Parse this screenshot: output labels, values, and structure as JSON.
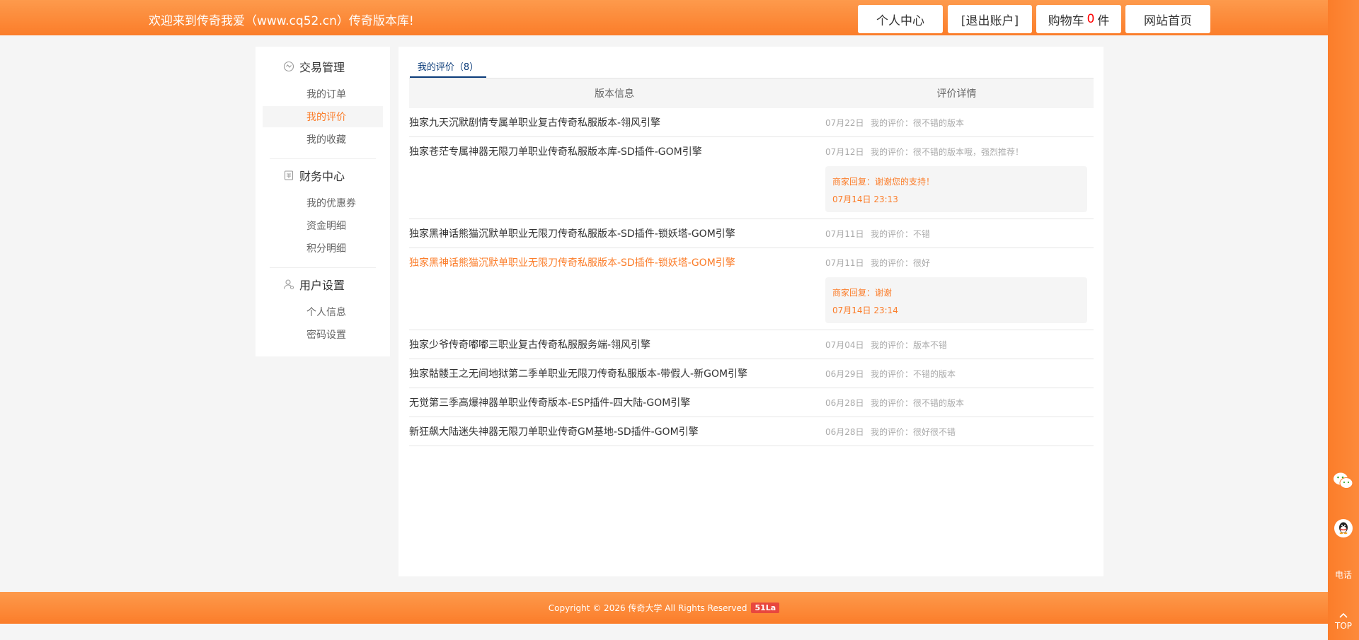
{
  "header": {
    "welcome": "欢迎来到传奇我爱（www.cq52.cn）传奇版本库!",
    "nav": {
      "personal_center": "个人中心",
      "logout": "[退出账户]",
      "cart_prefix": "购物车",
      "cart_count": "0",
      "cart_suffix": "件",
      "home": "网站首页"
    }
  },
  "sidebar": {
    "sections": [
      {
        "title": "交易管理",
        "icon": "transaction-icon",
        "links": [
          "我的订单",
          "我的评价",
          "我的收藏"
        ]
      },
      {
        "title": "财务中心",
        "icon": "finance-icon",
        "links": [
          "我的优惠券",
          "资金明细",
          "积分明细"
        ]
      },
      {
        "title": "用户设置",
        "icon": "user-icon",
        "links": [
          "个人信息",
          "密码设置"
        ]
      }
    ],
    "active_link": "我的评价"
  },
  "main": {
    "tab": "我的评价（8）",
    "columns": [
      "版本信息",
      "评价详情"
    ],
    "reviews": [
      {
        "title": "独家九天沉默剧情专属单职业复古传奇私服版本-翎风引擎",
        "date": "07月22日",
        "comment": "我的评价：很不错的版本"
      },
      {
        "title": "独家苍茫专属神器无限刀单职业传奇私服版本库-SD插件-GOM引擎",
        "date": "07月12日",
        "comment": "我的评价：很不错的版本哦，强烈推荐！",
        "reply": "商家回复：谢谢您的支持！",
        "reply_time": "07月14日 23:13"
      },
      {
        "title": "独家黑神话熊猫沉默单职业无限刀传奇私服版本-SD插件-锁妖塔-GOM引擎",
        "date": "07月11日",
        "comment": "我的评价：不错"
      },
      {
        "title": "独家黑神话熊猫沉默单职业无限刀传奇私服版本-SD插件-锁妖塔-GOM引擎",
        "date": "07月11日",
        "comment": "我的评价：很好",
        "reply": "商家回复：谢谢",
        "reply_time": "07月14日 23:14"
      },
      {
        "title": "独家少爷传奇嘟嘟三职业复古传奇私服服务端-翎风引擎",
        "date": "07月04日",
        "comment": "我的评价：版本不错"
      },
      {
        "title": "独家骷髅王之无间地狱第二季单职业无限刀传奇私服版本-带假人-新GOM引擎",
        "date": "06月29日",
        "comment": "我的评价：不错的版本"
      },
      {
        "title": "无觉第三季高爆神器单职业传奇版本-ESP插件-四大陆-GOM引擎",
        "date": "06月28日",
        "comment": "我的评价：很不错的版本"
      },
      {
        "title": "新狂飙大陆迷失神器无限刀单职业传奇GM基地-SD插件-GOM引擎",
        "date": "06月28日",
        "comment": "我的评价：很好很不错"
      }
    ]
  },
  "footer": {
    "copyright": "Copyright © 2026 传奇大学 All Rights Reserved",
    "badge": "51La"
  },
  "right_bar": {
    "items": [
      {
        "icon": "wechat-icon"
      },
      {
        "icon": "qq-icon"
      },
      {
        "label": "电话"
      },
      {
        "label": "TOP",
        "icon": "arrow-up-icon"
      }
    ]
  },
  "colors": {
    "accent": "#fb7d2a",
    "accent_light": "#fd9a4c",
    "tab_blue": "#0b3c7a",
    "badge_red": "#e8473e",
    "cart_count": "#ff0000"
  }
}
